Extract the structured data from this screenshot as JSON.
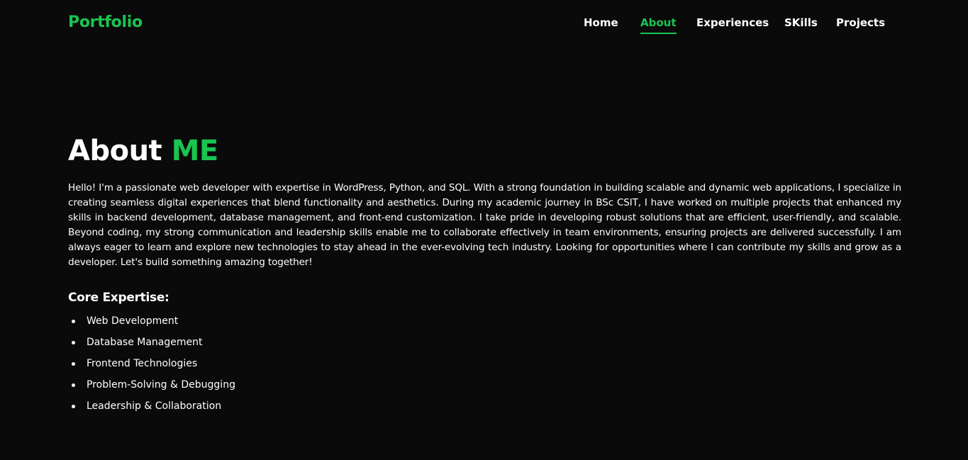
{
  "header": {
    "logo": "Portfolio",
    "nav": [
      {
        "label": "Home"
      },
      {
        "label": "About"
      },
      {
        "label": "Experiences"
      },
      {
        "label": "SKills"
      },
      {
        "label": "Projects"
      }
    ],
    "active_nav": "About"
  },
  "about": {
    "title_prefix": "About",
    "title_accent": "ME",
    "description": "Hello! I'm a passionate web developer with expertise in WordPress, Python, and SQL. With a strong foundation in building scalable and dynamic web applications, I specialize in creating seamless digital experiences that blend functionality and aesthetics. During my academic journey in BSc CSIT, I have worked on multiple projects that enhanced my skills in backend development, database management, and front-end customization. I take pride in developing robust solutions that are efficient, user-friendly, and scalable. Beyond coding, my strong communication and leadership skills enable me to collaborate effectively in team environments, ensuring projects are delivered successfully. I am always eager to learn and explore new technologies to stay ahead in the ever-evolving tech industry. Looking for opportunities where I can contribute my skills and grow as a developer. Let's build something amazing together!",
    "core_title": "Core Expertise:",
    "core_items": [
      "Web Development",
      "Database Management",
      "Frontend Technologies",
      "Problem-Solving & Debugging",
      "Leadership & Collaboration"
    ]
  },
  "colors": {
    "background": "#0a0a0a",
    "accent": "#19c451",
    "text": "#ffffff"
  }
}
